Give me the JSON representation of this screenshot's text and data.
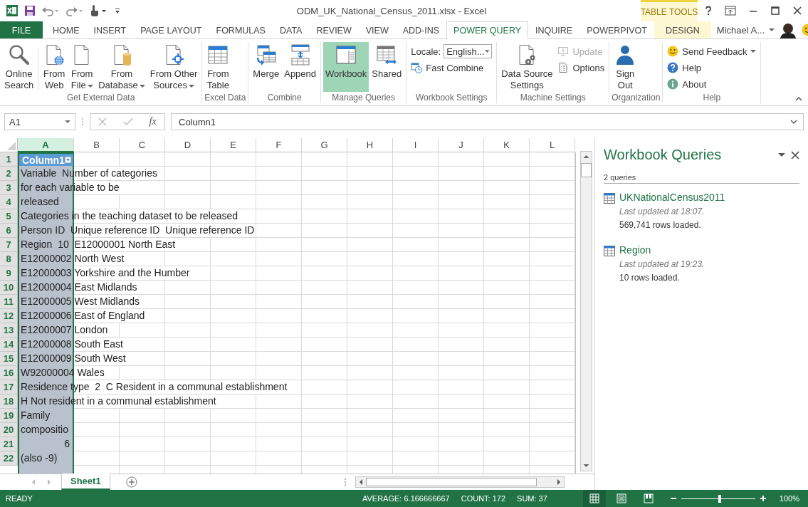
{
  "title_bar": {
    "title": "ODM_UK_National_Census_2011.xlsx - Excel",
    "context_label": "TABLE TOOLS"
  },
  "ribbon_tabs": [
    {
      "label": "FILE",
      "kind": "file",
      "selected": false
    },
    {
      "label": "HOME",
      "kind": "tab",
      "selected": false
    },
    {
      "label": "INSERT",
      "kind": "tab",
      "selected": false
    },
    {
      "label": "PAGE LAYOUT",
      "kind": "tab",
      "selected": false
    },
    {
      "label": "FORMULAS",
      "kind": "tab",
      "selected": false
    },
    {
      "label": "DATA",
      "kind": "tab",
      "selected": false
    },
    {
      "label": "REVIEW",
      "kind": "tab",
      "selected": false
    },
    {
      "label": "VIEW",
      "kind": "tab",
      "selected": false
    },
    {
      "label": "ADD-INS",
      "kind": "tab",
      "selected": false
    },
    {
      "label": "POWER QUERY",
      "kind": "tab",
      "selected": true
    },
    {
      "label": "INQUIRE",
      "kind": "tab",
      "selected": false
    },
    {
      "label": "POWERPIVOT",
      "kind": "tab",
      "selected": false
    },
    {
      "label": "DESIGN",
      "kind": "contextual",
      "selected": false
    }
  ],
  "user": {
    "name": "Michael A..."
  },
  "ribbon_groups": [
    {
      "label": "Get External Data",
      "buttons": [
        {
          "kind": "large",
          "label": "Online\nSearch",
          "dropdown": false,
          "selected": false,
          "disabled": false
        },
        {
          "kind": "large",
          "label": "From\nWeb",
          "dropdown": false,
          "selected": false,
          "disabled": false
        },
        {
          "kind": "large",
          "label": "From\nFile",
          "dropdown": true,
          "selected": false,
          "disabled": false
        },
        {
          "kind": "large",
          "label": "From\nDatabase",
          "dropdown": true,
          "selected": false,
          "disabled": false
        },
        {
          "kind": "large",
          "label": "From Other\nSources",
          "dropdown": true,
          "selected": false,
          "disabled": false
        }
      ]
    },
    {
      "label": "Excel Data",
      "buttons": [
        {
          "kind": "large",
          "label": "From\nTable",
          "dropdown": false,
          "selected": false,
          "disabled": false
        }
      ]
    },
    {
      "label": "Combine",
      "buttons": [
        {
          "kind": "large",
          "label": "Merge",
          "dropdown": false,
          "selected": false,
          "disabled": false
        },
        {
          "kind": "large",
          "label": "Append",
          "dropdown": false,
          "selected": false,
          "disabled": false
        }
      ]
    },
    {
      "label": "Manage Queries",
      "buttons": [
        {
          "kind": "large",
          "label": "Workbook",
          "dropdown": false,
          "selected": true,
          "disabled": false
        },
        {
          "kind": "large",
          "label": "Shared",
          "dropdown": false,
          "selected": false,
          "disabled": false
        }
      ]
    },
    {
      "label": "Workbook Settings",
      "buttons": [
        {
          "kind": "select",
          "label": "Locale:",
          "value": "English..."
        },
        {
          "kind": "small",
          "label": "Fast Combine",
          "dropdown": false,
          "selected": false,
          "disabled": false
        }
      ]
    },
    {
      "label": "Machine Settings",
      "buttons": [
        {
          "kind": "large",
          "label": "Data Source\nSettings",
          "dropdown": false,
          "selected": false,
          "disabled": false
        },
        {
          "kind": "small",
          "label": "Update",
          "dropdown": false,
          "selected": false,
          "disabled": true
        },
        {
          "kind": "small",
          "label": "Options",
          "dropdown": false,
          "selected": false,
          "disabled": false
        }
      ]
    },
    {
      "label": "Organization",
      "buttons": [
        {
          "kind": "large",
          "label": "Sign\nOut",
          "dropdown": false,
          "selected": false,
          "disabled": false
        }
      ]
    },
    {
      "label": "Help",
      "buttons": [
        {
          "kind": "small",
          "label": "Send Feedback",
          "dropdown": true,
          "selected": false,
          "disabled": false
        },
        {
          "kind": "small",
          "label": "Help",
          "dropdown": false,
          "selected": false,
          "disabled": false
        },
        {
          "kind": "small",
          "label": "About",
          "dropdown": false,
          "selected": false,
          "disabled": false
        }
      ]
    }
  ],
  "formula_bar": {
    "name_box": "A1",
    "function_label": "fx",
    "value": "Column1"
  },
  "columns": [
    {
      "label": "A",
      "selected": true
    },
    {
      "label": "B",
      "selected": false
    },
    {
      "label": "C",
      "selected": false
    },
    {
      "label": "D",
      "selected": false
    },
    {
      "label": "E",
      "selected": false
    },
    {
      "label": "F",
      "selected": false
    },
    {
      "label": "G",
      "selected": false
    },
    {
      "label": "H",
      "selected": false
    },
    {
      "label": "I",
      "selected": false
    },
    {
      "label": "J",
      "selected": false
    },
    {
      "label": "K",
      "selected": false
    },
    {
      "label": "L",
      "selected": false
    }
  ],
  "rows": [
    {
      "number": "1",
      "kind": "header",
      "text": "Column1"
    },
    {
      "number": "2",
      "kind": "text",
      "text": "Variable  Number of categories"
    },
    {
      "number": "3",
      "kind": "text",
      "text": "for each variable to be"
    },
    {
      "number": "4",
      "kind": "text",
      "text": "released"
    },
    {
      "number": "5",
      "kind": "text",
      "text": "Categories in the teaching dataset to be released"
    },
    {
      "number": "6",
      "kind": "text",
      "text": "Person ID  Unique reference ID  Unique reference ID"
    },
    {
      "number": "7",
      "kind": "text",
      "text": "Region  10  E12000001 North East"
    },
    {
      "number": "8",
      "kind": "text",
      "text": "E12000002 North West"
    },
    {
      "number": "9",
      "kind": "text",
      "text": "E12000003 Yorkshire and the Humber"
    },
    {
      "number": "10",
      "kind": "text",
      "text": "E12000004 East Midlands"
    },
    {
      "number": "11",
      "kind": "text",
      "text": "E12000005 West Midlands"
    },
    {
      "number": "12",
      "kind": "text",
      "text": "E12000006 East of England"
    },
    {
      "number": "13",
      "kind": "text",
      "text": "E12000007 London"
    },
    {
      "number": "14",
      "kind": "text",
      "text": "E12000008 South East"
    },
    {
      "number": "15",
      "kind": "text",
      "text": "E12000009 South West"
    },
    {
      "number": "16",
      "kind": "text",
      "text": "W92000004 Wales"
    },
    {
      "number": "17",
      "kind": "text",
      "text": "Residence type  2  C Resident in a communal establishment"
    },
    {
      "number": "18",
      "kind": "text",
      "text": "H Not resident in a communal establishment"
    },
    {
      "number": "19",
      "kind": "text",
      "text": "Family"
    },
    {
      "number": "20",
      "kind": "text",
      "text": "compositio"
    },
    {
      "number": "21",
      "kind": "number",
      "text": "6"
    },
    {
      "number": "22",
      "kind": "text",
      "text": "(also -9)"
    }
  ],
  "queries_pane": {
    "title": "Workbook Queries",
    "count": "2 queries",
    "queries": [
      {
        "name": "UKNationalCensus2011",
        "updated": "Last updated at 18:07.",
        "rows": "569,741 rows loaded."
      },
      {
        "name": "Region",
        "updated": "Last updated at 19:23.",
        "rows": "10 rows loaded."
      }
    ]
  },
  "sheets": [
    {
      "label": "Sheet1",
      "selected": true
    }
  ],
  "status_bar": {
    "mode": "READY",
    "average": "AVERAGE: 6.166666667",
    "count": "COUNT: 172",
    "sum": "SUM: 37",
    "views": [
      {
        "selected": true
      },
      {
        "selected": false
      },
      {
        "selected": false
      }
    ],
    "zoom": {
      "level": 0.5,
      "label": "100%"
    }
  }
}
